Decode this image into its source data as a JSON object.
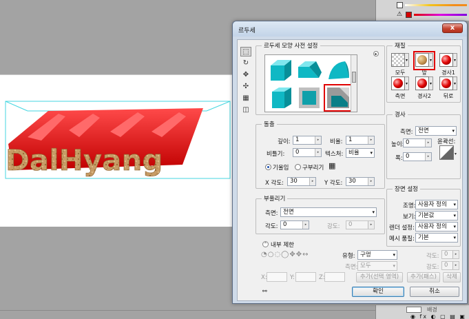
{
  "background": {
    "artwork_text": "DalHyang",
    "layer_name": "배경",
    "warning_symbol": "⚠",
    "panel_icons": "◉ fx ◐ ▢ ▤ ▣"
  },
  "dialog": {
    "title": "르두세",
    "close_label": "x",
    "tools": [
      "select-tool-icon",
      "rotate-tool-icon",
      "move-tool-icon",
      "scale-tool-icon",
      "texture-tool-icon",
      "camera-tool-icon"
    ],
    "presets": {
      "legend": "르두세 모양 사전 설정",
      "selected_index": 5
    },
    "material": {
      "legend": "재질",
      "items": [
        {
          "label": "모두",
          "kind": "checker"
        },
        {
          "label": "앞",
          "kind": "texture",
          "selected": true
        },
        {
          "label": "경사1",
          "kind": "sphere"
        },
        {
          "label": "측면",
          "kind": "sphere"
        },
        {
          "label": "경사2",
          "kind": "sphere"
        },
        {
          "label": "뒤로",
          "kind": "sphere"
        }
      ]
    },
    "extrude": {
      "legend": "돌출",
      "depth_label": "깊이:",
      "depth_value": "1",
      "scale_label": "비율:",
      "scale_value": "1",
      "twist_label": "비틀기:",
      "twist_value": "0",
      "texture_label": "텍스처:",
      "texture_value": "비율",
      "radio_bevel": "기울임",
      "radio_bend": "구부리기",
      "x_angle_label": "X 각도:",
      "x_angle_value": "30",
      "y_angle_label": "Y 각도:",
      "y_angle_value": "30"
    },
    "inflate": {
      "legend": "부풀리기",
      "side_label": "측면:",
      "side_value": "전면",
      "angle_label": "각도:",
      "angle_value": "0",
      "strength_label": "강도:",
      "strength_value": "0"
    },
    "bevel": {
      "legend": "경사",
      "side_label": "측면:",
      "side_value": "전면",
      "height_label": "높이:",
      "height_value": "0",
      "contour_label": "윤곽선:",
      "width_label": "폭:",
      "width_value": "0"
    },
    "scene": {
      "legend": "장면 설정",
      "lighting_label": "조명:",
      "lighting_value": "사용자 정의",
      "view_label": "보기:",
      "view_value": "기본값",
      "render_label": "렌더 설정:",
      "render_value": "사용자 정의",
      "mesh_label": "메시 품질:",
      "mesh_value": "기본"
    },
    "constraints": {
      "title": "내부 제한",
      "type_label": "유형:",
      "type_value": "구멍",
      "side_label": "측면:",
      "side_value": "모두",
      "angle_label": "각도:",
      "angle_value": "0",
      "strength_label": "강도:",
      "strength_value": "0",
      "x_label": "X:",
      "y_label": "Y:",
      "z_label": "Z:",
      "add_selection": "추가(선택 영역)",
      "add_path": "추가(패스)",
      "delete": "삭제"
    },
    "ok": "확인",
    "cancel": "취소"
  }
}
